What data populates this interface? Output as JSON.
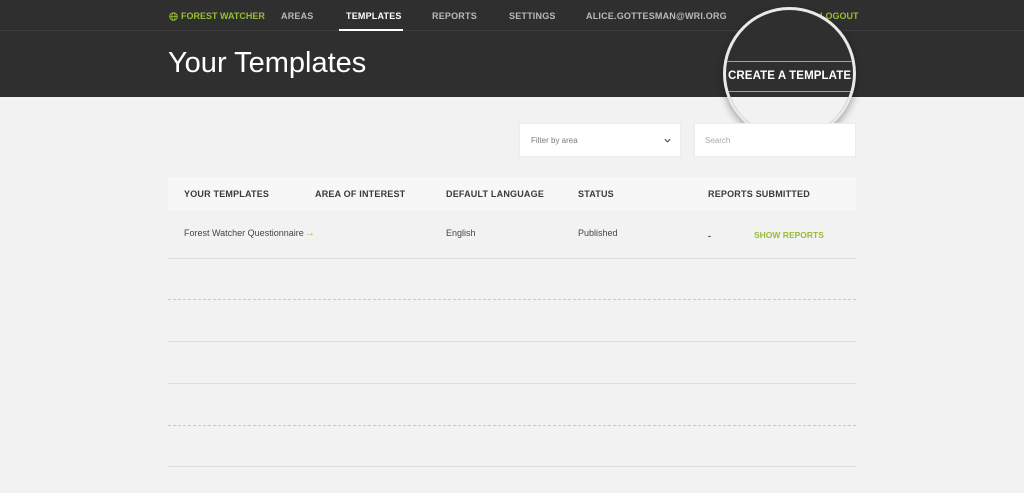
{
  "nav": {
    "brand": "FOREST WATCHER",
    "items": [
      {
        "label": "AREAS"
      },
      {
        "label": "TEMPLATES"
      },
      {
        "label": "REPORTS"
      },
      {
        "label": "SETTINGS"
      },
      {
        "label": "ALICE.GOTTESMAN@WRI.ORG"
      }
    ],
    "active_item": "TEMPLATES",
    "logout": "LOGOUT"
  },
  "header": {
    "title": "Your Templates",
    "create_button": "CREATE A TEMPLATE"
  },
  "filters": {
    "area_select": "Filter by area",
    "search_placeholder": "Search"
  },
  "table": {
    "columns": [
      "YOUR TEMPLATES",
      "AREA OF INTEREST",
      "DEFAULT LANGUAGE",
      "STATUS",
      "REPORTS SUBMITTED"
    ],
    "rows": [
      {
        "name": "Forest Watcher Questionnaire",
        "area": "",
        "language": "English",
        "status": "Published",
        "reports": "-",
        "action": "SHOW REPORTS"
      }
    ]
  },
  "colors": {
    "accent": "#97be32",
    "header_bg": "#2f2f2f",
    "page_bg": "#f2f2f2"
  },
  "icons": {
    "brand": "globe-icon",
    "select": "chevron-down-icon",
    "row_link": "arrow-right-icon"
  }
}
